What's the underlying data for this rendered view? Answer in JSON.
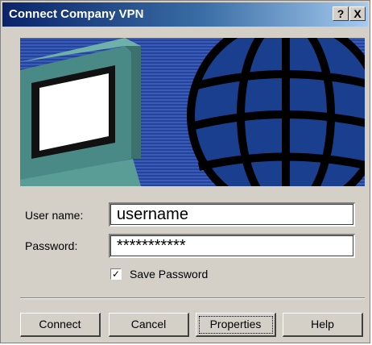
{
  "window": {
    "title": "Connect Company VPN",
    "help_glyph": "?",
    "close_glyph": "X"
  },
  "form": {
    "username_label": "User name:",
    "username_value": "username",
    "password_label": "Password:",
    "password_value": "***********",
    "save_password_label": "Save Password",
    "save_password_checked": true,
    "checkmark": "✓"
  },
  "buttons": {
    "connect": "Connect",
    "cancel": "Cancel",
    "properties": "Properties",
    "help": "Help"
  },
  "colors": {
    "title_gradient_start": "#0a246a",
    "banner_blue": "#2e4ea6",
    "dialog_face": "#d4d0c8"
  }
}
